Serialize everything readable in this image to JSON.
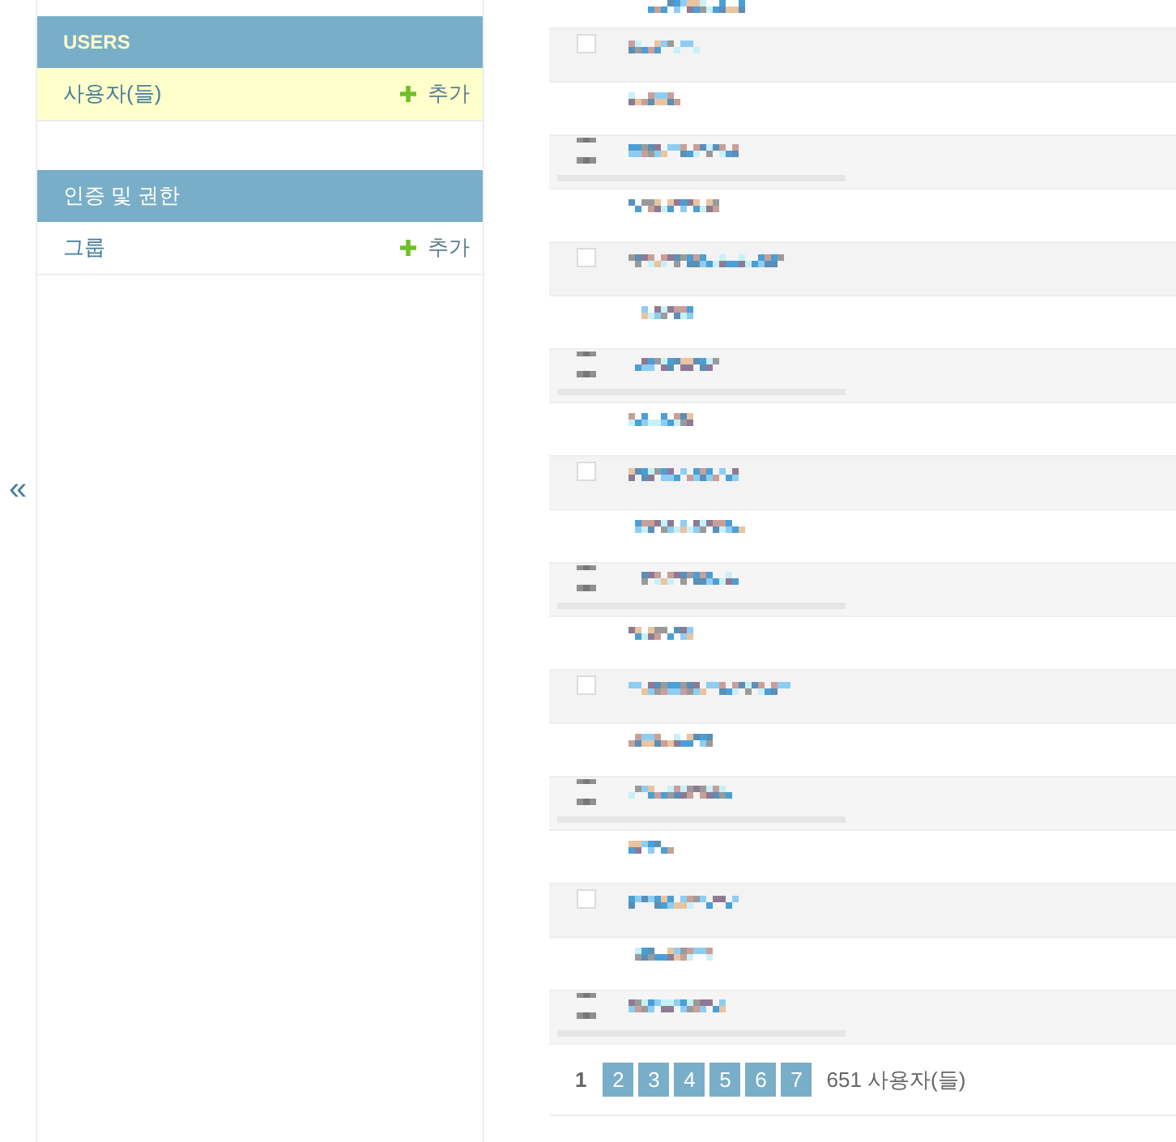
{
  "sidebar_toggle": {
    "label": "«"
  },
  "sidebar": {
    "apps": [
      {
        "caption": "USERS",
        "current": true,
        "models": [
          {
            "name": "사용자(들)",
            "add": "추가",
            "current": true
          }
        ]
      },
      {
        "caption": "인증 및 권한",
        "current": false,
        "models": [
          {
            "name": "그룹",
            "add": "추가",
            "current": false
          }
        ]
      }
    ]
  },
  "results": {
    "rows": [
      {
        "kind": "text"
      },
      {
        "kind": "checkbox",
        "checked": false
      },
      {
        "kind": "text"
      },
      {
        "kind": "bars"
      },
      {
        "kind": "text"
      },
      {
        "kind": "checkbox",
        "checked": false
      },
      {
        "kind": "text"
      },
      {
        "kind": "bars"
      },
      {
        "kind": "text"
      },
      {
        "kind": "checkbox",
        "checked": false
      },
      {
        "kind": "text"
      },
      {
        "kind": "bars"
      },
      {
        "kind": "text"
      },
      {
        "kind": "checkbox",
        "checked": false
      },
      {
        "kind": "text"
      },
      {
        "kind": "bars"
      },
      {
        "kind": "text"
      },
      {
        "kind": "checkbox",
        "checked": false
      },
      {
        "kind": "text"
      },
      {
        "kind": "bars"
      }
    ]
  },
  "paginator": {
    "pages": [
      {
        "label": "1",
        "selected": true
      },
      {
        "label": "2",
        "selected": false
      },
      {
        "label": "3",
        "selected": false
      },
      {
        "label": "4",
        "selected": false
      },
      {
        "label": "5",
        "selected": false
      },
      {
        "label": "6",
        "selected": false
      },
      {
        "label": "7",
        "selected": false
      }
    ],
    "count": "651 사용자(들)"
  }
}
